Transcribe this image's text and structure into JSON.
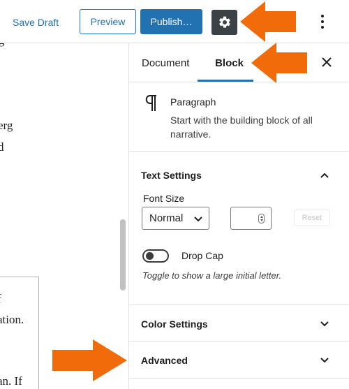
{
  "toolbar": {
    "save_draft": "Save Draft",
    "preview": "Preview",
    "publish": "Publish…",
    "settings_icon": "gear-icon",
    "more_icon": "vertical-ellipsis-icon"
  },
  "editor": {
    "fragments": [
      "g",
      "erg",
      "d",
      "f",
      "ation.",
      "an. If"
    ]
  },
  "sidebar": {
    "tabs": [
      {
        "label": "Document",
        "active": false
      },
      {
        "label": "Block",
        "active": true
      }
    ],
    "close_icon": "close-icon",
    "block": {
      "icon": "paragraph-icon",
      "name": "Paragraph",
      "description": "Start with the building block of all narrative."
    },
    "text_settings": {
      "title": "Text Settings",
      "expanded": true,
      "font_size_label": "Font Size",
      "font_size_value": "Normal",
      "custom_size_value": "",
      "reset_label": "Reset",
      "drop_cap_label": "Drop Cap",
      "drop_cap_on": false,
      "drop_cap_help": "Toggle to show a large initial letter."
    },
    "color_settings": {
      "title": "Color Settings",
      "expanded": false
    },
    "advanced": {
      "title": "Advanced",
      "expanded": false
    }
  },
  "colors": {
    "accent": "#2271b1",
    "settings_button_bg": "#3c4146",
    "annotation_arrow": "#f26b0a"
  }
}
